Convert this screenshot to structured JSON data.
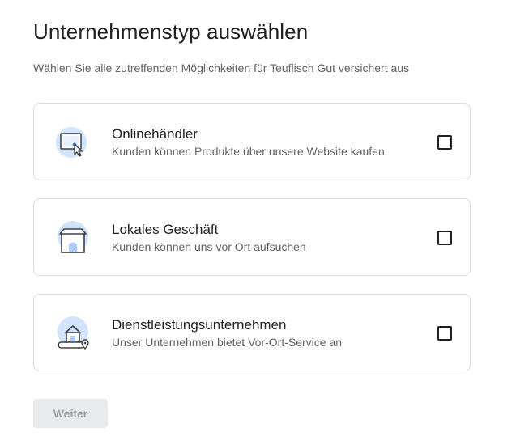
{
  "header": {
    "title": "Unternehmenstyp auswählen",
    "subtitle": "Wählen Sie alle zutreffenden Möglichkeiten für Teuflisch Gut versichert aus"
  },
  "options": [
    {
      "title": "Onlinehändler",
      "description": "Kunden können Produkte über unsere Website kaufen",
      "icon": "computer-click-icon",
      "checked": false
    },
    {
      "title": "Lokales Geschäft",
      "description": "Kunden können uns vor Ort aufsuchen",
      "icon": "storefront-icon",
      "checked": false
    },
    {
      "title": "Dienstleistungsunternehmen",
      "description": "Unser Unternehmen bietet Vor-Ort-Service an",
      "icon": "house-location-icon",
      "checked": false
    }
  ],
  "actions": {
    "continue_label": "Weiter",
    "continue_enabled": false
  },
  "colors": {
    "icon_circle": "#d2e3fc",
    "icon_stroke": "#3c4043",
    "icon_accent": "#aecbfa",
    "border": "#dadce0",
    "button_bg": "#e8eaed",
    "button_text": "#9aa0a6"
  }
}
